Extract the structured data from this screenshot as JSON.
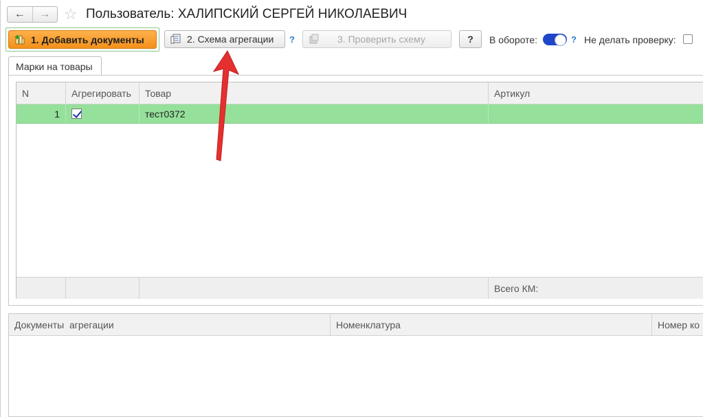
{
  "header": {
    "title": "Пользователь: ХАЛИПСКИЙ СЕРГЕЙ НИКОЛАЕВИЧ",
    "back_icon": "←",
    "forward_icon": "→",
    "star_icon": "☆"
  },
  "toolbar": {
    "add_documents_label": "1. Добавить документы",
    "aggregation_scheme_label": "2. Схема агрегации",
    "check_scheme_label": "3. Проверить схему",
    "help_label": "?",
    "help_link": "?",
    "in_circulation_label": "В обороте:",
    "in_circulation_value": true,
    "no_check_label": "Не делать проверку:",
    "no_check_value": false
  },
  "tabs": [
    {
      "label": "Марки на товары",
      "active": true
    }
  ],
  "marks_table": {
    "columns": [
      "N",
      "Агрегировать",
      "Товар",
      "Артикул"
    ],
    "rows": [
      {
        "n": "1",
        "aggregate": true,
        "product": "тест0372",
        "article": ""
      }
    ],
    "footer_total_label": "Всего КМ:"
  },
  "documents_table": {
    "columns": [
      "Документы  агрегации",
      "Номенклатура",
      "Номер ко"
    ]
  },
  "colors": {
    "accent_orange": "#f3901c",
    "selected_row": "#95e09a",
    "toggle_on": "#1f45c9",
    "annotation_arrow": "#e53030"
  }
}
